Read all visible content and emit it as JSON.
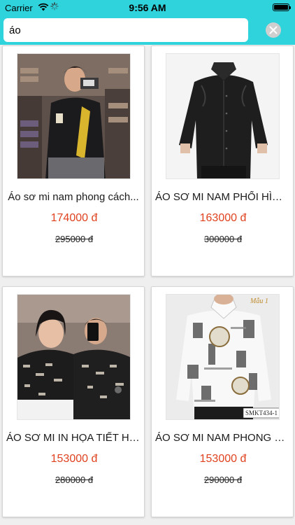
{
  "status_bar": {
    "carrier": "Carrier",
    "time": "9:56 AM"
  },
  "search": {
    "value": "áo"
  },
  "products": [
    {
      "name": "Áo sơ mi nam phong cách...",
      "price": "174000 đ",
      "old_price": "295000 đ"
    },
    {
      "name": "ÁO SƠ MI NAM PHỐI HÌNH...",
      "price": "163000 đ",
      "old_price": "300000 đ"
    },
    {
      "name": "ÁO SƠ MI IN HỌA TIẾT HÌN...",
      "price": "153000 đ",
      "old_price": "280000 đ"
    },
    {
      "name": "ÁO SƠ MI NAM PHONG CÁ...",
      "price": "153000 đ",
      "old_price": "290000 đ",
      "image_tags": [
        "Mẫu 1",
        "SMKT434-1"
      ]
    }
  ],
  "colors": {
    "header": "#2fd3dc",
    "price": "#e0411f"
  }
}
